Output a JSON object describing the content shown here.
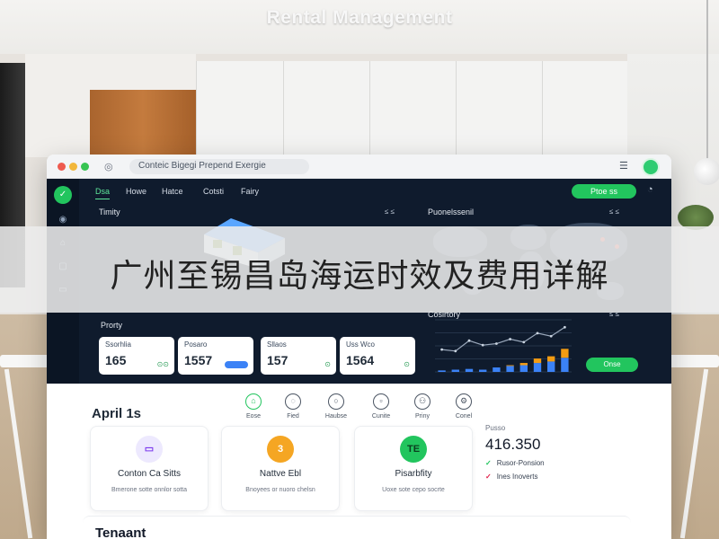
{
  "page": {
    "title": "Rental Management"
  },
  "banner": {
    "text": "广州至锡昌岛海运时效及费用详解"
  },
  "window": {
    "address": "Conteic  Bigegi  Prepend Exergie",
    "menu_icon": "menu-icon",
    "avatar_color": "#2ecc71"
  },
  "nav": {
    "items": [
      "Dsa",
      "Howe",
      "Hatce",
      "Cotsti",
      "Fairy"
    ],
    "cta_label": "Ptoe ss",
    "icons": [
      "logo-icon",
      "user-icon",
      "home-icon",
      "doc-icon",
      "folder-icon"
    ]
  },
  "panels": {
    "left_title": "Timity",
    "left_meta": "≤ ≤",
    "map_title": "Puonelssenil",
    "map_meta": "≤ ≤",
    "properties_title": "Prorty",
    "chart_title": "Cosirtory",
    "chart_meta": "≤ ≤",
    "chart_button": "Onse"
  },
  "stats": [
    {
      "label": "Ssorhlia",
      "value": "165",
      "extra": "⊙⊙"
    },
    {
      "label": "Posaro",
      "value": "1557",
      "extra": ""
    },
    {
      "label": "Sllaos",
      "value": "157",
      "extra": "⊙"
    },
    {
      "label": "Uss Wco",
      "value": "1564",
      "extra": "⊙"
    }
  ],
  "chart_data": {
    "type": "bar",
    "title": "Cosirtory",
    "categories": [
      "1",
      "2",
      "3",
      "4",
      "5",
      "6",
      "7",
      "8",
      "9",
      "10"
    ],
    "series": [
      {
        "values": [
          2,
          3,
          4,
          3,
          6,
          8,
          9,
          12,
          14,
          19
        ]
      },
      {
        "values": [
          0,
          0,
          0,
          0,
          0,
          1,
          3,
          6,
          7,
          12
        ]
      }
    ],
    "line": [
      30,
      28,
      42,
      36,
      38,
      44,
      40,
      52,
      48,
      60
    ],
    "ylim": [
      0,
      70
    ],
    "legend": "top-right",
    "colors": {
      "bar": "#3b82f6",
      "bar_top": "#f39c12",
      "line": "#9aa8bb"
    }
  },
  "section": {
    "title": "April 1s"
  },
  "toolbar": [
    {
      "label": "Eose",
      "icon": "home-icon",
      "active": true
    },
    {
      "label": "Fied",
      "icon": "chat-icon",
      "active": false
    },
    {
      "label": "Haubse",
      "icon": "bubble-icon",
      "active": false
    },
    {
      "label": "Cunite",
      "icon": "calendar-icon",
      "active": false
    },
    {
      "label": "Priny",
      "icon": "people-icon",
      "active": false
    },
    {
      "label": "Conel",
      "icon": "settings-icon",
      "active": false
    }
  ],
  "features": [
    {
      "title": "Conton Ca Sitts",
      "sub": "Bmerone sotte onnlor sotta",
      "icon": "chat-icon",
      "glyph": "▭",
      "color": "#7c3aed",
      "bg": "#ede9fe"
    },
    {
      "title": "Nattve Ebl",
      "sub": "Bnoyees or nuoro chelsn",
      "icon": "wallet-icon",
      "glyph": "3",
      "color": "#ffffff",
      "bg": "#f5a623"
    },
    {
      "title": "Pisarbfity",
      "sub": "Uoxe sote cepo socrte",
      "icon": "badge-icon",
      "glyph": "TE",
      "color": "#0b3d1f",
      "bg": "#22c55e"
    }
  ],
  "summary": {
    "label": "Pusso",
    "value": "416.350",
    "items": [
      {
        "text": "Rusor-Ponsion",
        "mark": "✓",
        "tone": "green"
      },
      {
        "text": "Ines Inoverts",
        "mark": "✓",
        "tone": "red"
      }
    ]
  },
  "tenant": {
    "title": "Tenaant"
  }
}
